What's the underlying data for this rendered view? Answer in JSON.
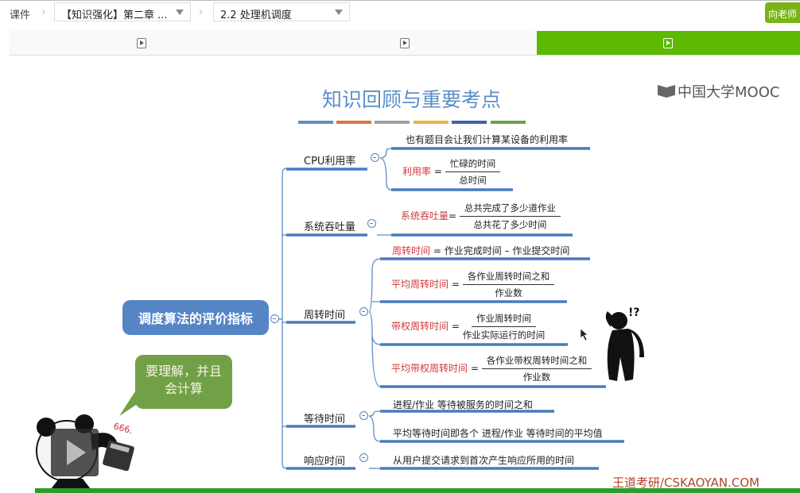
{
  "topbar": {
    "crumb_root": "课件",
    "chapter_select": "【知识强化】第二章 ...",
    "section_select": "2.2 处理机调度",
    "ask_teacher_button": "向老师"
  },
  "tabs": [
    {
      "icon": "play-icon",
      "active": false
    },
    {
      "icon": "play-icon",
      "active": false
    },
    {
      "icon": "play-icon",
      "active": true
    }
  ],
  "slide": {
    "title": "知识回顾与重要考点",
    "title_bar_colors": [
      "#5b8fc7",
      "#d9783f",
      "#a0a0a0",
      "#eab33c",
      "#3f62a8",
      "#72a046"
    ],
    "logo": "中国大学MOOC",
    "root": "调度算法的评价指标",
    "branches": {
      "cpu": {
        "label": "CPU利用率",
        "leaf1": "也有题目会让我们计算某设备的利用率",
        "f_name": "利用率",
        "f_eq": "=",
        "f_num": "忙碌的时间",
        "f_den": "总时间"
      },
      "throughput": {
        "label": "系统吞吐量",
        "f_name": "系统吞吐量",
        "f_eq": "=",
        "f_num": "总共完成了多少道作业",
        "f_den": "总共花了多少时间"
      },
      "turnaround": {
        "label": "周转时间",
        "l1_name": "周转时间",
        "l1_rest": " = 作业完成时间 – 作业提交时间",
        "l2_name": "平均周转时间",
        "l2_num": "各作业周转时间之和",
        "l2_den": "作业数",
        "l3_name": "带权周转时间",
        "l3_num": "作业周转时间",
        "l3_den": "作业实际运行的时间",
        "l4_name": "平均带权周转时间",
        "l4_num": "各作业带权周转时间之和",
        "l4_den": "作业数",
        "eq": "="
      },
      "waiting": {
        "label": "等待时间",
        "leaf1": "进程/作业 等待被服务的时间之和",
        "leaf2": "平均等待时间即各个 进程/作业 等待时间的平均值"
      },
      "response": {
        "label": "响应时间",
        "leaf1": "从用户提交请求到首次产生响应所用的时间"
      }
    },
    "speech_bubble": "要理解，并且会计算",
    "sticker_text": "666.",
    "confused_mark": "!?",
    "watermark": "王道考研/CSKAOYAN.COM",
    "accent_colors": {
      "node": "#5585c5",
      "highlight": "#d0383b",
      "tab_active": "#5cb800"
    }
  }
}
